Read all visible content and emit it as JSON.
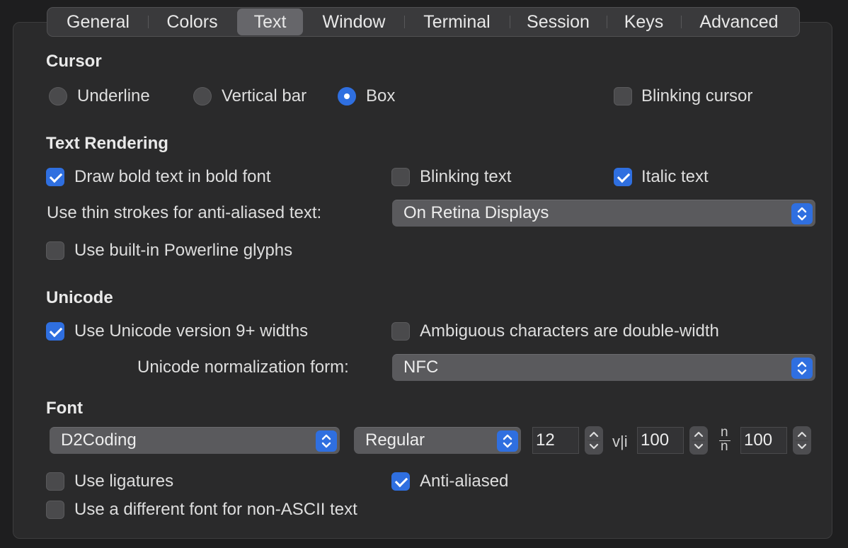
{
  "tabs": [
    {
      "label": "General"
    },
    {
      "label": "Colors"
    },
    {
      "label": "Text",
      "selected": true
    },
    {
      "label": "Window"
    },
    {
      "label": "Terminal"
    },
    {
      "label": "Session"
    },
    {
      "label": "Keys"
    },
    {
      "label": "Advanced"
    }
  ],
  "cursor": {
    "heading": "Cursor",
    "underline": {
      "label": "Underline",
      "selected": false
    },
    "vertical_bar": {
      "label": "Vertical bar",
      "selected": false
    },
    "box": {
      "label": "Box",
      "selected": true
    },
    "blinking_cursor": {
      "label": "Blinking cursor",
      "checked": false
    }
  },
  "text_rendering": {
    "heading": "Text Rendering",
    "draw_bold": {
      "label": "Draw bold text in bold font",
      "checked": true
    },
    "blinking_text": {
      "label": "Blinking text",
      "checked": false
    },
    "italic_text": {
      "label": "Italic text",
      "checked": true
    },
    "thin_strokes_label": "Use thin strokes for anti-aliased text:",
    "thin_strokes_value": "On Retina Displays",
    "powerline": {
      "label": "Use built-in Powerline glyphs",
      "checked": false
    }
  },
  "unicode": {
    "heading": "Unicode",
    "v9_widths": {
      "label": "Use Unicode version 9+ widths",
      "checked": true
    },
    "ambiguous_double": {
      "label": "Ambiguous characters are double-width",
      "checked": false
    },
    "normalization_label": "Unicode normalization form:",
    "normalization_value": "NFC"
  },
  "font": {
    "heading": "Font",
    "family": "D2Coding",
    "style": "Regular",
    "size": "12",
    "vertical_spacing_glyph": "v|i",
    "vertical_spacing": "100",
    "horizontal_spacing_glyph_top": "n",
    "horizontal_spacing_glyph_bottom": "n",
    "horizontal_spacing": "100",
    "ligatures": {
      "label": "Use ligatures",
      "checked": false
    },
    "anti_aliased": {
      "label": "Anti-aliased",
      "checked": true
    },
    "non_ascii_font": {
      "label": "Use a different font for non-ASCII text",
      "checked": false
    }
  },
  "colors": {
    "accent": "#2f6fe0",
    "window_bg": "#1e1e1f",
    "panel_bg": "#2a2a2b"
  }
}
